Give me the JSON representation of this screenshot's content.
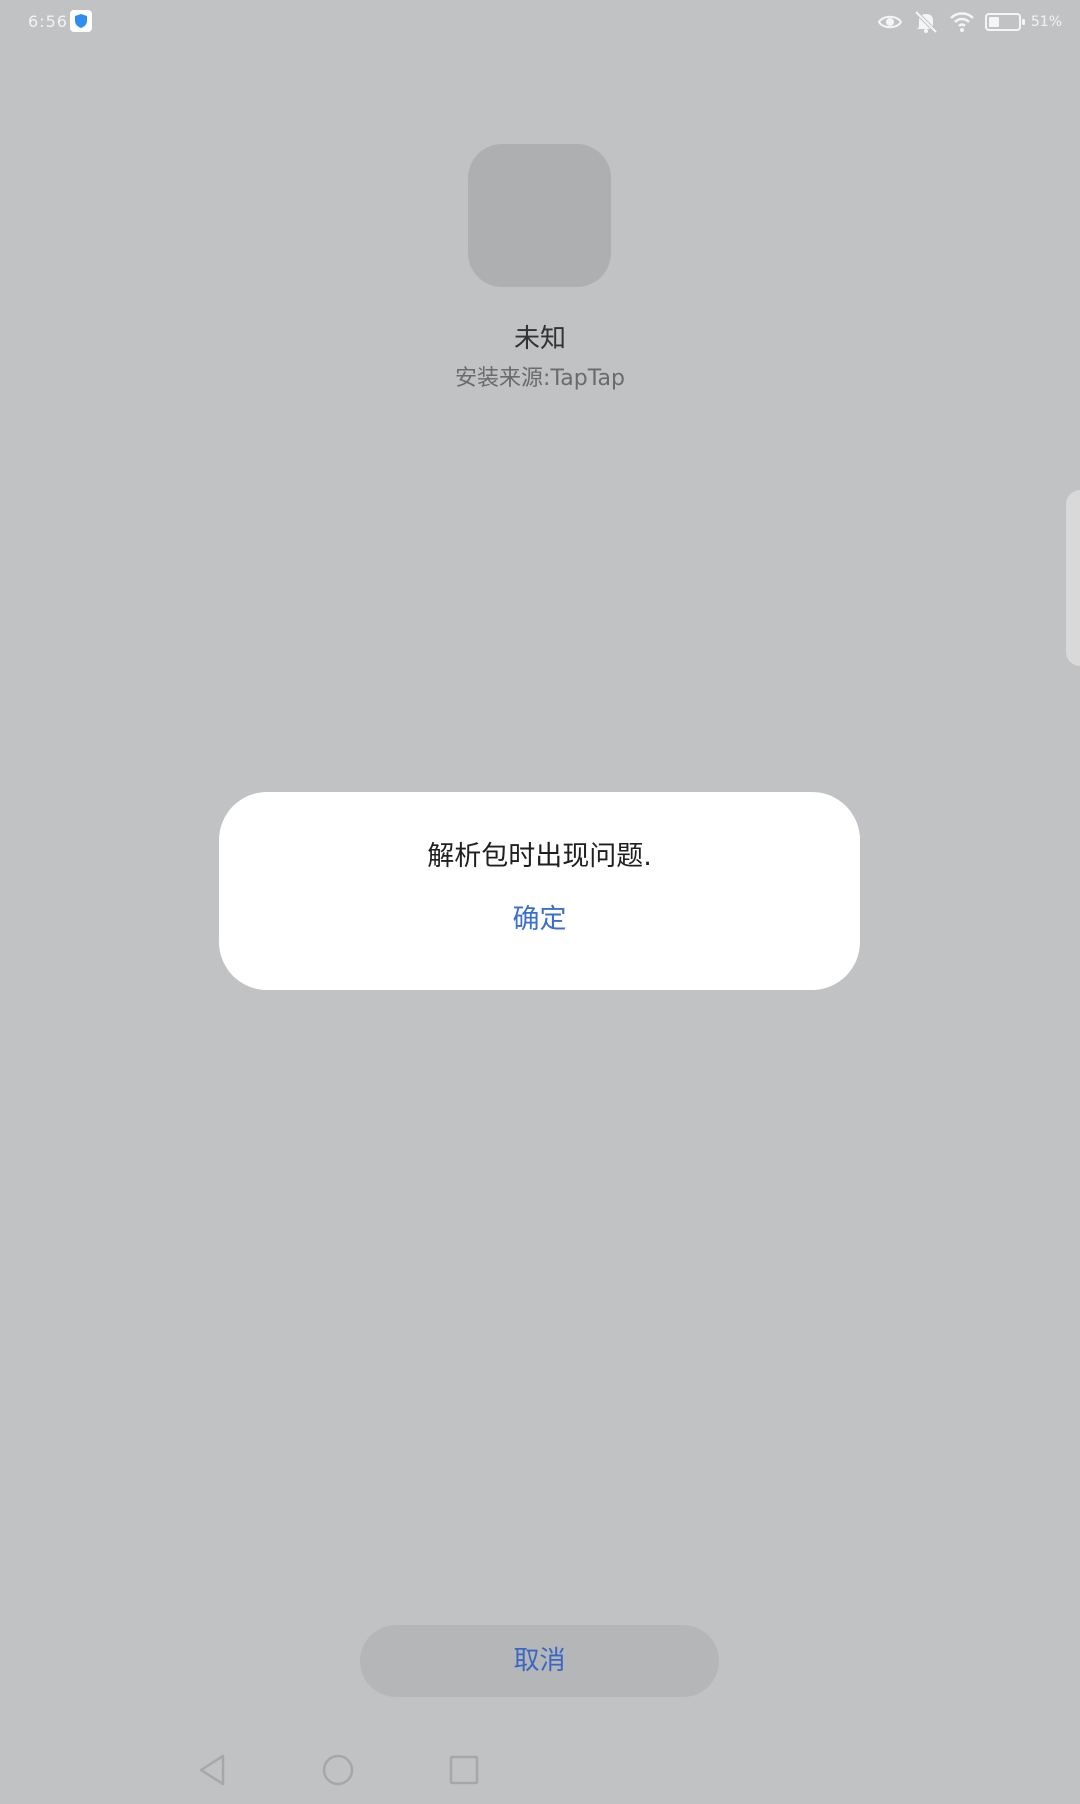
{
  "status_bar": {
    "time": "6:56",
    "battery_text": "51%",
    "battery_level": 0.35,
    "icons": [
      "shield-icon",
      "eye-icon",
      "bell-off-icon",
      "wifi-icon",
      "battery-icon"
    ]
  },
  "app": {
    "name": "未知",
    "install_source": "安装来源:TapTap"
  },
  "dialog": {
    "message": "解析包时出现问题.",
    "confirm_label": "确定"
  },
  "footer": {
    "cancel_label": "取消"
  },
  "nav_bar": {
    "icons": [
      "back-icon",
      "home-icon",
      "recents-icon"
    ]
  },
  "colors": {
    "background": "#c1c2c4",
    "accent": "#3b6fcf",
    "dialog": "#ffffff"
  }
}
